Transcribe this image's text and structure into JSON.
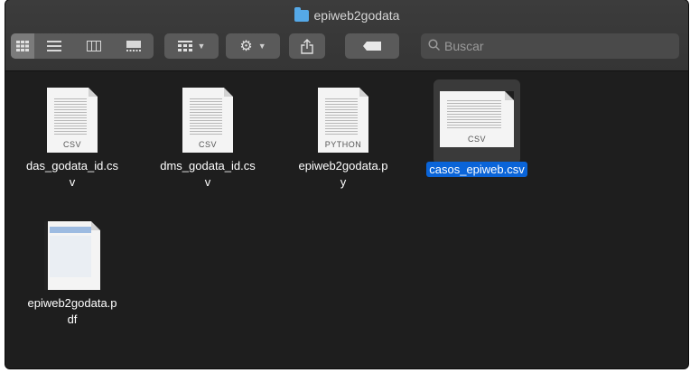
{
  "window": {
    "title": "epiweb2godata"
  },
  "toolbar": {
    "view_buttons": [
      "icon-view",
      "list-view",
      "column-view",
      "gallery-view"
    ],
    "search_placeholder": "Buscar"
  },
  "files": [
    {
      "name": "das_godata_id.csv",
      "label_line1": "das_godata_id.cs",
      "label_line2": "v",
      "type_tag": "CSV",
      "selected": false
    },
    {
      "name": "dms_godata_id.csv",
      "label_line1": "dms_godata_id.cs",
      "label_line2": "v",
      "type_tag": "CSV",
      "selected": false
    },
    {
      "name": "epiweb2godata.py",
      "label_line1": "epiweb2godata.p",
      "label_line2": "y",
      "type_tag": "PYTHON",
      "selected": false
    },
    {
      "name": "casos_epiweb.csv",
      "label_line1": "casos_epiweb.csv",
      "label_line2": "",
      "type_tag": "CSV",
      "selected": true
    },
    {
      "name": "epiweb2godata.pdf",
      "label_line1": "epiweb2godata.p",
      "label_line2": "df",
      "type_tag": "",
      "selected": false
    }
  ],
  "colors": {
    "selection": "#0a64d8",
    "folder": "#55a9e8"
  }
}
